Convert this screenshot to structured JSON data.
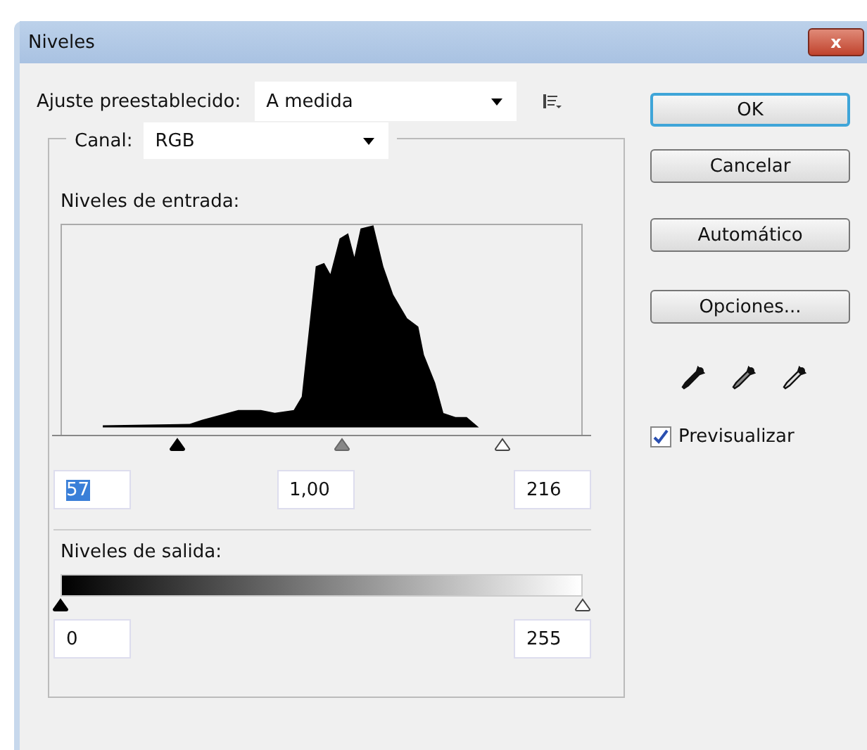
{
  "window": {
    "title": "Niveles",
    "close": "x"
  },
  "preset": {
    "label": "Ajuste preestablecido:",
    "value": "A medida"
  },
  "channel": {
    "label": "Canal:",
    "value": "RGB"
  },
  "input_levels": {
    "label": "Niveles de entrada:",
    "sliders": [
      {
        "kind": "black",
        "level": 0.224
      },
      {
        "kind": "gray",
        "level": 0.54
      },
      {
        "kind": "white",
        "level": 0.847
      }
    ],
    "fields": [
      {
        "value": "57",
        "highlighted": true
      },
      {
        "value": "1,00",
        "highlighted": false
      },
      {
        "value": "216",
        "highlighted": false
      }
    ]
  },
  "output_levels": {
    "label": "Niveles de salida:",
    "sliders": [
      {
        "kind": "black",
        "level": 0
      },
      {
        "kind": "white",
        "level": 1
      }
    ],
    "fields": [
      {
        "value": "0"
      },
      {
        "value": "255"
      }
    ]
  },
  "buttons": [
    {
      "label": "OK",
      "default": true
    },
    {
      "label": "Cancelar",
      "default": false
    },
    {
      "label": "Automático",
      "default": false
    },
    {
      "label": "Opciones...",
      "default": false
    }
  ],
  "eyedroppers": [
    {
      "kind": "black"
    },
    {
      "kind": "gray"
    },
    {
      "kind": "white"
    }
  ],
  "preview": {
    "label": "Previsualizar",
    "checked": true
  }
}
